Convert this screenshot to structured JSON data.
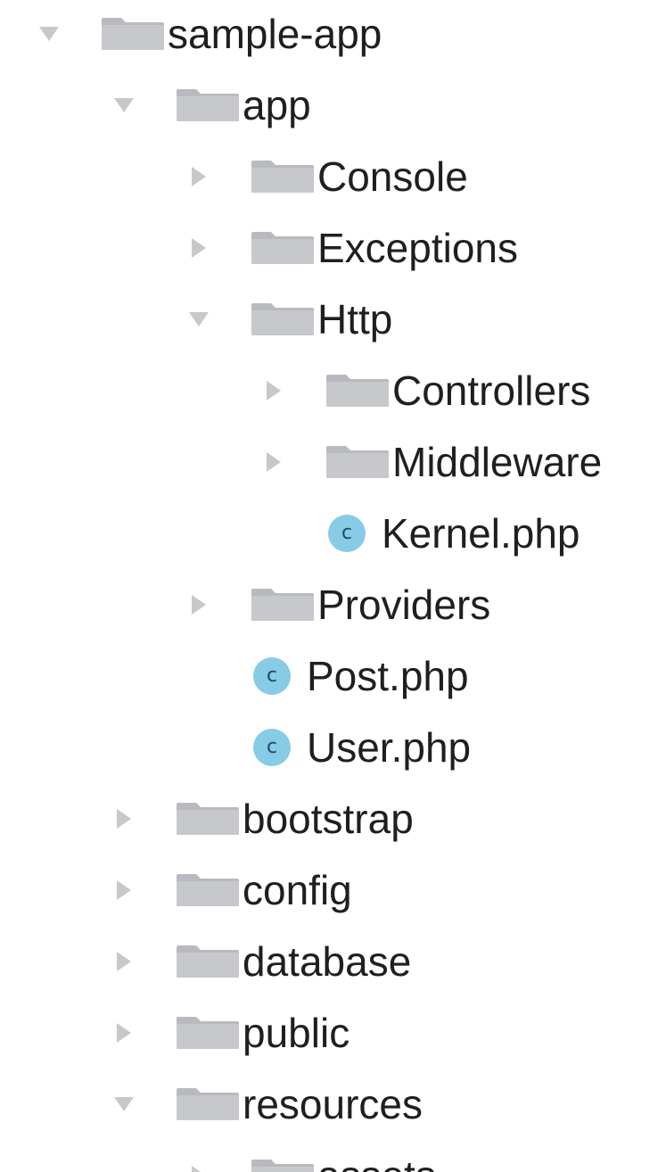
{
  "tree": {
    "rows": [
      {
        "label": "sample-app",
        "type": "folder",
        "state": "expanded",
        "depth": 0
      },
      {
        "label": "app",
        "type": "folder",
        "state": "expanded",
        "depth": 1
      },
      {
        "label": "Console",
        "type": "folder",
        "state": "collapsed",
        "depth": 2
      },
      {
        "label": "Exceptions",
        "type": "folder",
        "state": "collapsed",
        "depth": 2
      },
      {
        "label": "Http",
        "type": "folder",
        "state": "expanded",
        "depth": 2
      },
      {
        "label": "Controllers",
        "type": "folder",
        "state": "collapsed",
        "depth": 3
      },
      {
        "label": "Middleware",
        "type": "folder",
        "state": "collapsed",
        "depth": 3
      },
      {
        "label": "Kernel.php",
        "type": "class",
        "state": "none",
        "depth": 3
      },
      {
        "label": "Providers",
        "type": "folder",
        "state": "collapsed",
        "depth": 2
      },
      {
        "label": "Post.php",
        "type": "class",
        "state": "none",
        "depth": 2
      },
      {
        "label": "User.php",
        "type": "class",
        "state": "none",
        "depth": 2
      },
      {
        "label": "bootstrap",
        "type": "folder",
        "state": "collapsed",
        "depth": 1
      },
      {
        "label": "config",
        "type": "folder",
        "state": "collapsed",
        "depth": 1
      },
      {
        "label": "database",
        "type": "folder",
        "state": "collapsed",
        "depth": 1
      },
      {
        "label": "public",
        "type": "folder",
        "state": "collapsed",
        "depth": 1
      },
      {
        "label": "resources",
        "type": "folder",
        "state": "expanded",
        "depth": 1
      },
      {
        "label": "assets",
        "type": "folder",
        "state": "collapsed",
        "depth": 2
      }
    ]
  },
  "icons": {
    "folder": "folder-icon",
    "class_file": "php-class-icon",
    "class_badge": "c",
    "expanded": "disclosure-triangle-down-icon",
    "collapsed": "disclosure-triangle-right-icon"
  },
  "colors": {
    "folder": "#c6c8cc",
    "folder_tab": "#b8babf",
    "class_badge": "#87cbe6",
    "class_letter": "#1f4b5a",
    "triangle": "#c8c8c8",
    "text": "#1f1f1f"
  }
}
